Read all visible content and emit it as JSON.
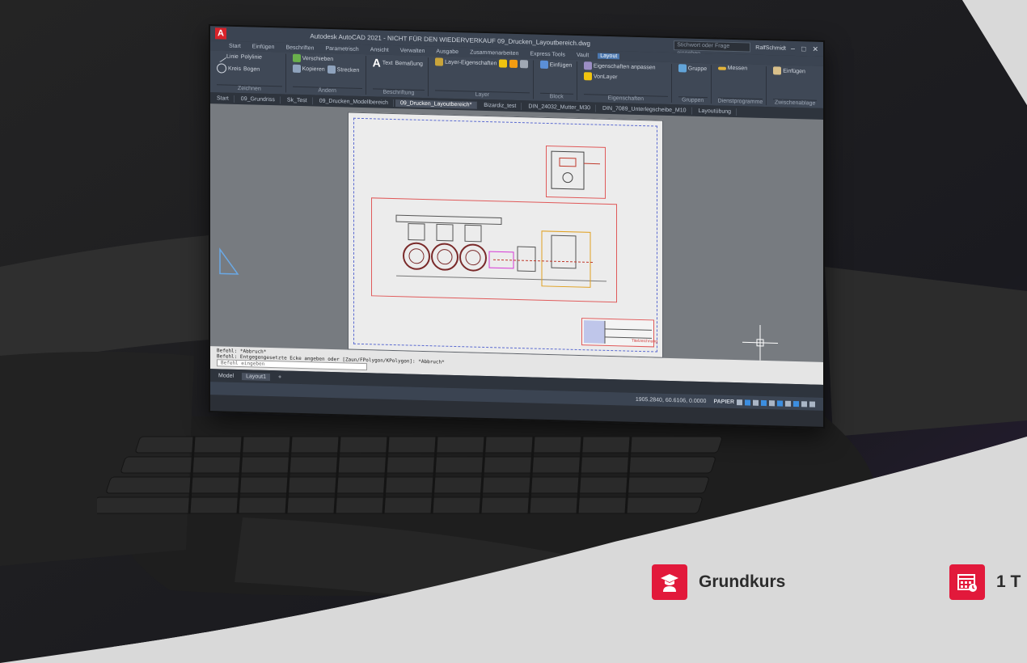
{
  "app": {
    "logo_letter": "A",
    "title": "Autodesk AutoCAD 2021 - NICHT FÜR DEN WIEDERVERKAUF   09_Drucken_Layoutbereich.dwg",
    "search_placeholder": "Stichwort oder Frage eingeben",
    "user": "RalfSchmidt"
  },
  "ribbon": {
    "tabs": [
      "Start",
      "Einfügen",
      "Beschriften",
      "Parametrisch",
      "Ansicht",
      "Verwalten",
      "Ausgabe",
      "Zusammenarbeiten",
      "Express Tools",
      "Vault",
      "Layout"
    ],
    "active_tab": "Layout",
    "panels": [
      {
        "label": "Zeichnen",
        "tools": [
          "Linie",
          "Polylinie",
          "Kreis",
          "Bogen"
        ]
      },
      {
        "label": "Ändern",
        "tools": [
          "Verschieben",
          "Kopieren",
          "Strecken"
        ]
      },
      {
        "label": "Beschriftung",
        "tools": [
          "Text",
          "Bemaßung"
        ]
      },
      {
        "label": "Layer",
        "tools": [
          "Layer-Eigenschaften"
        ]
      },
      {
        "label": "Block",
        "tools": [
          "Einfügen"
        ]
      },
      {
        "label": "Eigenschaften",
        "tools": [
          "Eigenschaften anpassen",
          "VonLayer"
        ]
      },
      {
        "label": "Gruppen",
        "tools": [
          "Gruppe"
        ]
      },
      {
        "label": "Dienstprogramme",
        "tools": [
          "Messen"
        ]
      },
      {
        "label": "Zwischenablage",
        "tools": [
          "Einfügen"
        ]
      }
    ]
  },
  "doc_tabs": [
    {
      "label": "Start",
      "active": false
    },
    {
      "label": "09_Grundriss",
      "active": false
    },
    {
      "label": "Sk_Test",
      "active": false
    },
    {
      "label": "09_Drucken_Modellbereich",
      "active": false
    },
    {
      "label": "09_Drucken_Layoutbereich*",
      "active": true
    },
    {
      "label": "Bizardiz_test",
      "active": false
    },
    {
      "label": "DIN_24032_Mutter_M30",
      "active": false
    },
    {
      "label": "DIN_7089_Unterlegscheibe_M10",
      "active": false
    },
    {
      "label": "Layoutübung",
      "active": false
    }
  ],
  "drawing": {
    "title_block_text": "Titelzeichnung"
  },
  "command": {
    "line1": "Befehl: *Abbruch*",
    "line2": "Befehl: Entgegengesetzte Ecke angeben oder [Zaun/FPolygon/KPolygon]: *Abbruch*",
    "input_placeholder": "Befehl eingeben"
  },
  "layout_tabs": [
    {
      "label": "Model",
      "active": false
    },
    {
      "label": "Layout1",
      "active": true
    },
    {
      "label": "+",
      "active": false
    }
  ],
  "statusbar": {
    "coords": "1905.2840, 60.6106, 0.0000",
    "mode": "PAPIER"
  },
  "badges": [
    {
      "icon": "graduate-icon",
      "label": "Grundkurs"
    },
    {
      "icon": "calendar-clock-icon",
      "label": "1 T"
    }
  ],
  "colors": {
    "accent": "#e2193b",
    "workspace": "#777b80",
    "ribbon": "#3f4856"
  }
}
